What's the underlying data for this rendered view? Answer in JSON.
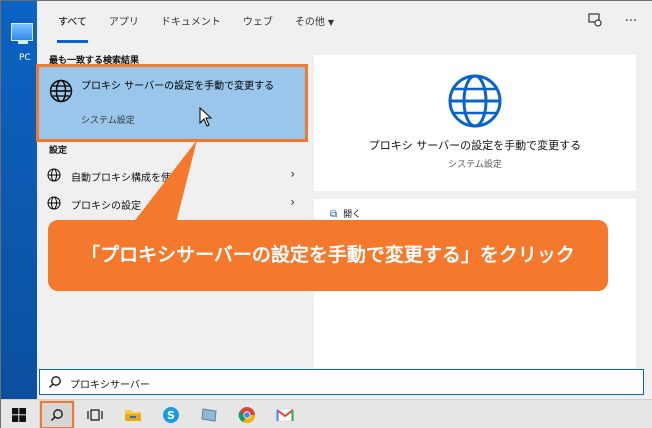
{
  "desktop": {
    "icon_label": "PC"
  },
  "tabs": {
    "all": "すべて",
    "apps": "アプリ",
    "documents": "ドキュメント",
    "web": "ウェブ",
    "other": "その他"
  },
  "best_match": {
    "heading": "最も一致する検索結果",
    "title": "プロキシ サーバーの設定を手動で変更する",
    "subtitle": "システム設定"
  },
  "settings": {
    "heading": "設定",
    "items": [
      {
        "label": "自動プロキシ構成を使う"
      },
      {
        "label": "プロキシの設定"
      }
    ]
  },
  "detail": {
    "title": "プロキシ サーバーの設定を手動で変更する",
    "subtitle": "システム設定",
    "open_label": "開く"
  },
  "search": {
    "query": "プロキシサーバー"
  },
  "callout": {
    "text": "「プロキシサーバーの設定を手動で変更する」をクリック"
  },
  "colors": {
    "accent": "#0a63c9",
    "highlight": "#f4792c",
    "selected": "#99c6ea"
  },
  "icons": [
    "globe-icon",
    "chevron-right-icon",
    "search-icon",
    "windows-start-icon",
    "task-view-icon",
    "file-explorer-icon",
    "skype-icon",
    "chrome-icon",
    "gmail-icon"
  ]
}
